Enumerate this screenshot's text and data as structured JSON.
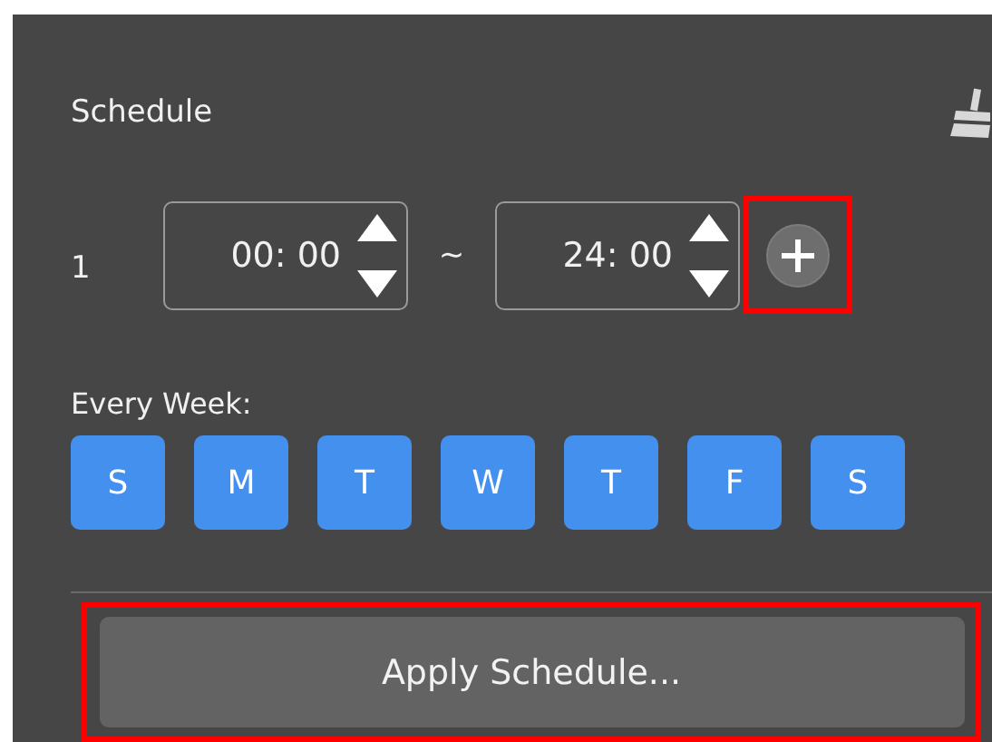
{
  "panel": {
    "title": "Schedule"
  },
  "time_ranges": [
    {
      "index": "1",
      "start": "00: 00",
      "separator": "~",
      "end": "24: 00",
      "add_highlighted": true
    }
  ],
  "week": {
    "label": "Every Week:",
    "days": [
      {
        "label": "S",
        "selected": true
      },
      {
        "label": "M",
        "selected": true
      },
      {
        "label": "T",
        "selected": true
      },
      {
        "label": "W",
        "selected": true
      },
      {
        "label": "T",
        "selected": true
      },
      {
        "label": "F",
        "selected": true
      },
      {
        "label": "S",
        "selected": true
      }
    ]
  },
  "apply_button": {
    "label": "Apply Schedule...",
    "highlighted": true
  }
}
